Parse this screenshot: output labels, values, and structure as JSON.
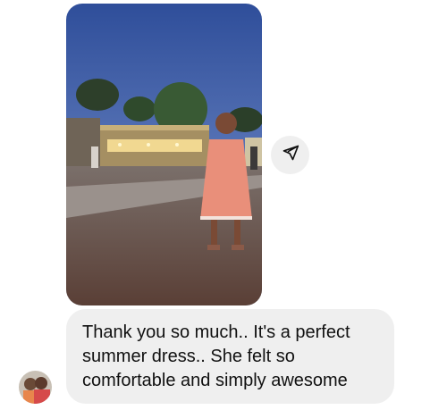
{
  "thread": {
    "photo_message": {
      "kind": "image",
      "subject": "toddler-in-pink-dress-at-dusk"
    },
    "share_button": {
      "icon": "send-arrow-icon"
    },
    "text_message": {
      "lines": [
        "Thank you so much.. It's a perfect",
        "summer dress.. She felt so",
        "comfortable and simply awesome"
      ]
    },
    "sender": {
      "avatar": "profile-photo"
    }
  },
  "colors": {
    "bubble": "#efefef",
    "text": "#111111",
    "background": "#ffffff",
    "share_button": "#efefef"
  }
}
